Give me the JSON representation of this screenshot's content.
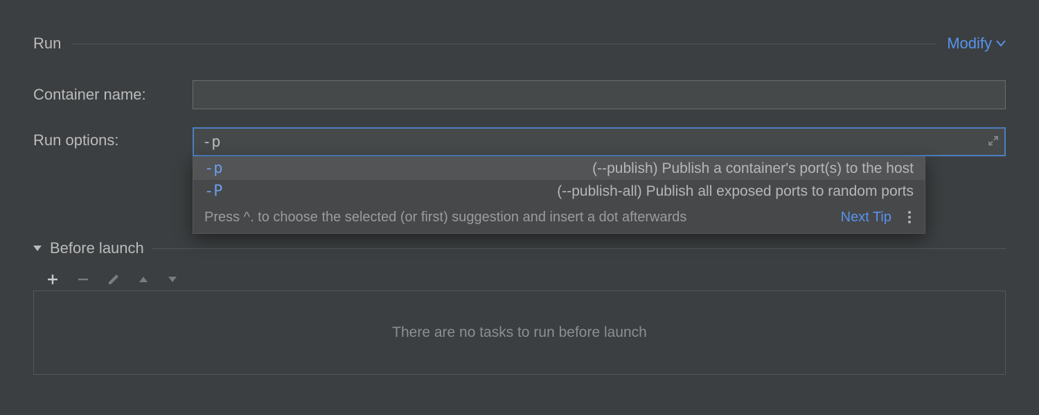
{
  "section": {
    "title": "Run",
    "modify_label": "Modify"
  },
  "form": {
    "container_name_label": "Container name:",
    "run_options_label": "Run options:",
    "run_options_value": "-p"
  },
  "completion": {
    "items": [
      {
        "flag": "-p",
        "desc": "(--publish) Publish a container's port(s) to the host",
        "selected": true
      },
      {
        "flag": "-P",
        "desc": "(--publish-all) Publish all exposed ports to random ports",
        "selected": false
      }
    ],
    "tip": "Press ^. to choose the selected (or first) suggestion and insert a dot afterwards",
    "next_tip": "Next Tip"
  },
  "before_launch": {
    "title": "Before launch",
    "empty_text": "There are no tasks to run before launch"
  }
}
